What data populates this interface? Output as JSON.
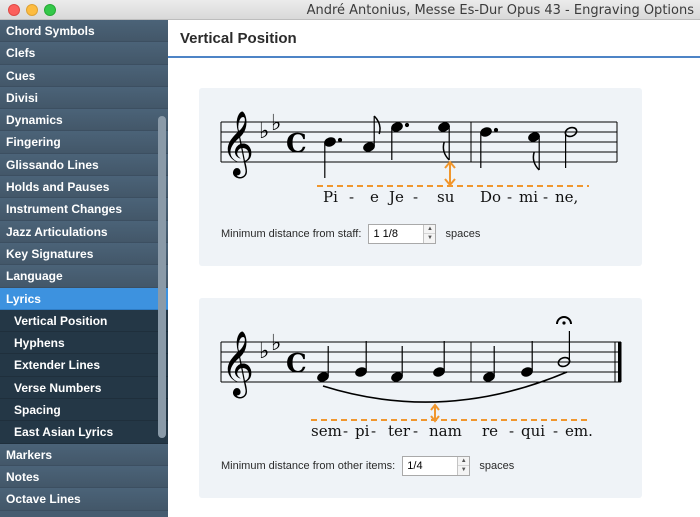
{
  "window": {
    "title": "André Antonius, Messe Es-Dur Opus 43 - Engraving Options"
  },
  "sidebar": {
    "items": [
      {
        "label": "Chord Symbols",
        "level": 0
      },
      {
        "label": "Clefs",
        "level": 0
      },
      {
        "label": "Cues",
        "level": 0
      },
      {
        "label": "Divisi",
        "level": 0
      },
      {
        "label": "Dynamics",
        "level": 0
      },
      {
        "label": "Fingering",
        "level": 0
      },
      {
        "label": "Glissando Lines",
        "level": 0
      },
      {
        "label": "Holds and Pauses",
        "level": 0
      },
      {
        "label": "Instrument Changes",
        "level": 0
      },
      {
        "label": "Jazz Articulations",
        "level": 0
      },
      {
        "label": "Key Signatures",
        "level": 0
      },
      {
        "label": "Language",
        "level": 0
      },
      {
        "label": "Lyrics",
        "level": 0,
        "active": true
      },
      {
        "label": "Vertical Position",
        "level": 1
      },
      {
        "label": "Hyphens",
        "level": 1
      },
      {
        "label": "Extender Lines",
        "level": 1
      },
      {
        "label": "Verse Numbers",
        "level": 1
      },
      {
        "label": "Spacing",
        "level": 1
      },
      {
        "label": "East Asian Lyrics",
        "level": 1
      },
      {
        "label": "Markers",
        "level": 0
      },
      {
        "label": "Notes",
        "level": 0
      },
      {
        "label": "Octave Lines",
        "level": 0
      }
    ]
  },
  "main": {
    "section_title": "Vertical Position",
    "example1": {
      "lyrics": [
        "Pi",
        "-",
        "e",
        "Je",
        "-",
        "su",
        "Do",
        "-",
        "mi",
        "-",
        "ne,"
      ],
      "option_label": "Minimum distance from staff:",
      "value": "1 1/8",
      "unit": "spaces"
    },
    "example2": {
      "lyrics": [
        "sem",
        "-",
        "pi",
        "-",
        "ter",
        "-",
        "nam",
        "re",
        "-",
        "qui",
        "-",
        "em."
      ],
      "option_label": "Minimum distance from other items:",
      "value": "1/4",
      "unit": "spaces"
    }
  },
  "colors": {
    "sidebar_bg": "#465c70",
    "sidebar_sub_bg": "#243746",
    "sidebar_active": "#3d92df",
    "header_rule": "#4d84c6",
    "panel_bg": "#eff3f7",
    "guide_orange": "#f0962d"
  },
  "icons": {
    "treble_clef": "𝄞",
    "common_time": "𝄴",
    "fermata": "𝄐",
    "flat": "♭"
  }
}
